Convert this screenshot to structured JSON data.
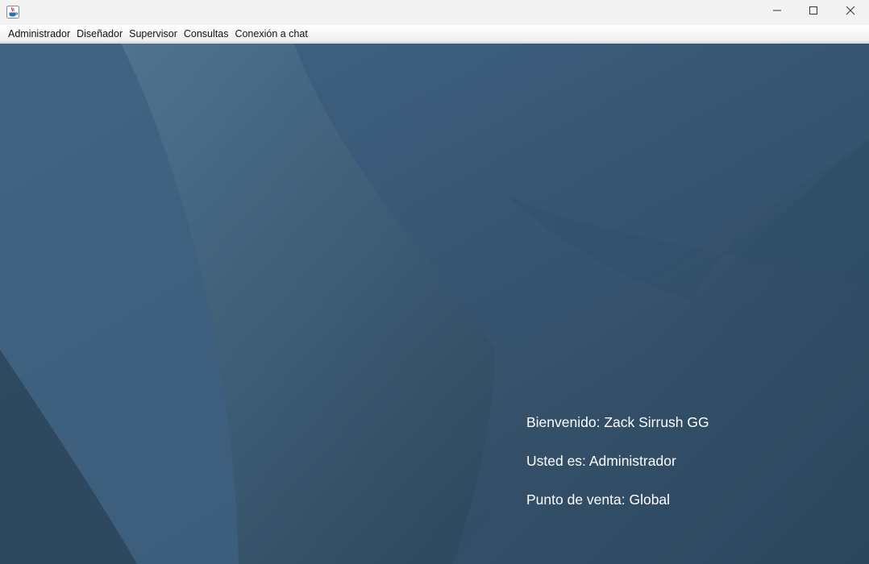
{
  "window": {
    "app_icon": "java-cup-icon",
    "controls": {
      "minimize_icon": "minimize-icon",
      "maximize_icon": "maximize-icon",
      "close_icon": "close-icon"
    }
  },
  "menubar": {
    "items": [
      {
        "label": "Administrador"
      },
      {
        "label": "Diseñador"
      },
      {
        "label": "Supervisor"
      },
      {
        "label": "Consultas"
      },
      {
        "label": "Conexión a chat"
      }
    ]
  },
  "session": {
    "welcome": "Bienvenido: Zack Sirrush GG",
    "role": "Usted es: Administrador",
    "point_of_sale": "Punto de venta: Global"
  },
  "colors": {
    "background": "#34526b",
    "text": "#ffffff"
  }
}
